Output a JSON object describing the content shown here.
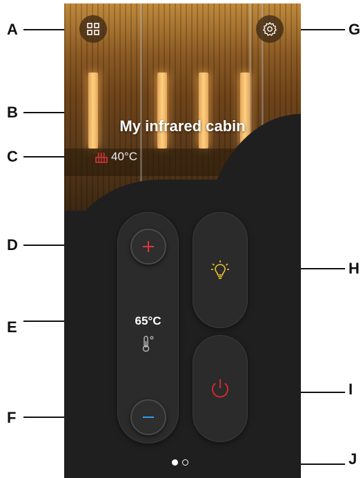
{
  "annotations": {
    "a": "A",
    "b": "B",
    "c": "C",
    "d": "D",
    "e": "E",
    "f": "F",
    "g": "G",
    "h": "H",
    "i": "I",
    "j": "J"
  },
  "header": {
    "title": "My infrared cabin",
    "current_temp": "40°C",
    "menu_icon": "grid-icon",
    "settings_icon": "gear-icon"
  },
  "temperature_control": {
    "setpoint": "65°C",
    "increase_icon": "plus-icon",
    "decrease_icon": "minus-icon",
    "unit_icon": "thermometer-icon"
  },
  "controls": {
    "light_icon": "lightbulb-icon",
    "power_icon": "power-icon"
  },
  "pagination": {
    "total": 2,
    "active": 1
  },
  "colors": {
    "background": "#1f1f1f",
    "plus": "#e0353c",
    "minus": "#2f9fe8",
    "light": "#f2c230",
    "power": "#d42a2a",
    "heater": "#e0353c"
  }
}
